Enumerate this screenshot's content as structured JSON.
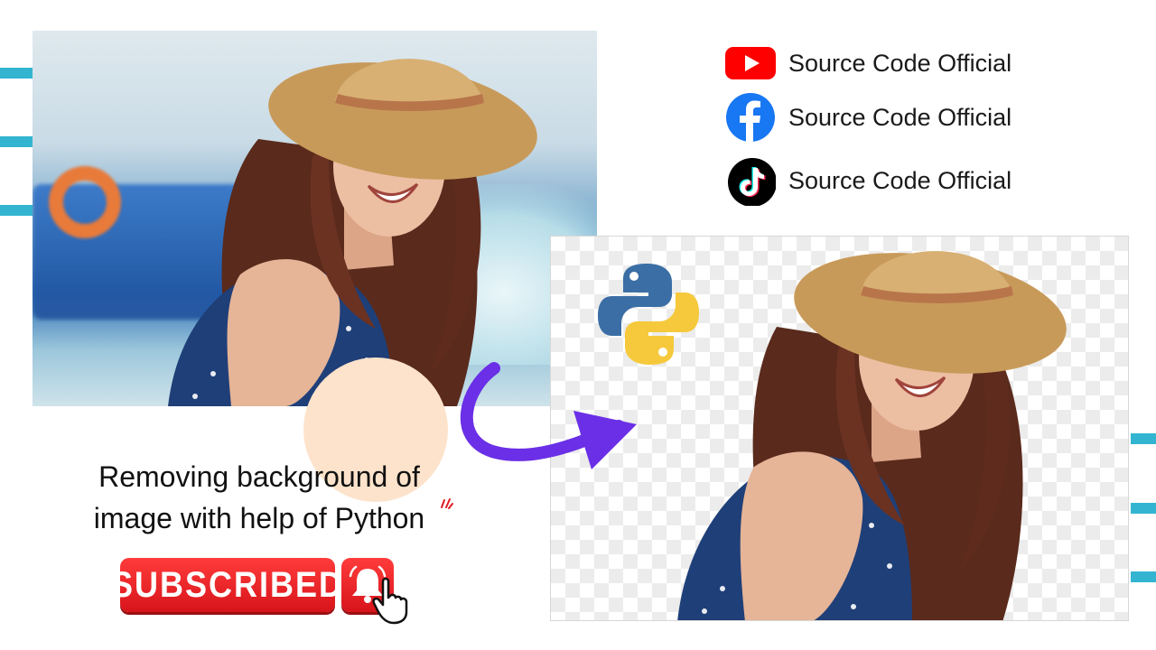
{
  "social": [
    {
      "platform": "youtube",
      "icon": "youtube-icon",
      "label": "Source Code Official",
      "color": "#ff0000"
    },
    {
      "platform": "facebook",
      "icon": "facebook-icon",
      "label": "Source Code Official",
      "color": "#1877f2"
    },
    {
      "platform": "tiktok",
      "icon": "tiktok-icon",
      "label": "Source Code Official",
      "color": "#000000"
    }
  ],
  "caption": {
    "line1": "Removing background of",
    "line2": "image with help of Python"
  },
  "subscribe_button": {
    "label": "SUBSCRIBED",
    "icon": "bell-icon",
    "color": "#e01b22"
  },
  "colors": {
    "accent_dash": "#33b5d1",
    "arrow": "#6a2fe6",
    "peach": "#fde3cb"
  },
  "logo": {
    "icon": "python-logo-icon"
  }
}
